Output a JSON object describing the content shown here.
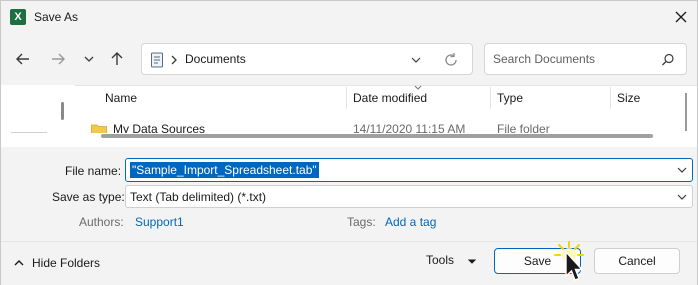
{
  "window": {
    "title": "Save As",
    "app_icon_letter": "X"
  },
  "address": {
    "path": "Documents"
  },
  "search": {
    "placeholder": "Search Documents"
  },
  "columns": [
    {
      "label": "Name"
    },
    {
      "label": "Date modified"
    },
    {
      "label": "Type"
    },
    {
      "label": "Size"
    }
  ],
  "partial_row": {
    "name": "My Data Sources",
    "date": "14/11/2020 11:15 AM",
    "type": "File folder"
  },
  "form": {
    "file_name_label": "File name:",
    "file_name_value": "\"Sample_Import_Spreadsheet.tab\"",
    "save_as_type_label": "Save as type:",
    "save_as_type_value": "Text (Tab delimited) (*.txt)",
    "authors_label": "Authors:",
    "authors_value": "Support1",
    "tags_label": "Tags:",
    "tags_value": "Add a tag"
  },
  "footer": {
    "hide_folders": "Hide Folders",
    "tools": "Tools",
    "save": "Save",
    "cancel": "Cancel"
  },
  "colors": {
    "accent": "#0067c0",
    "excel_green": "#1d6f42",
    "cursor_highlight": "#f5d400"
  }
}
